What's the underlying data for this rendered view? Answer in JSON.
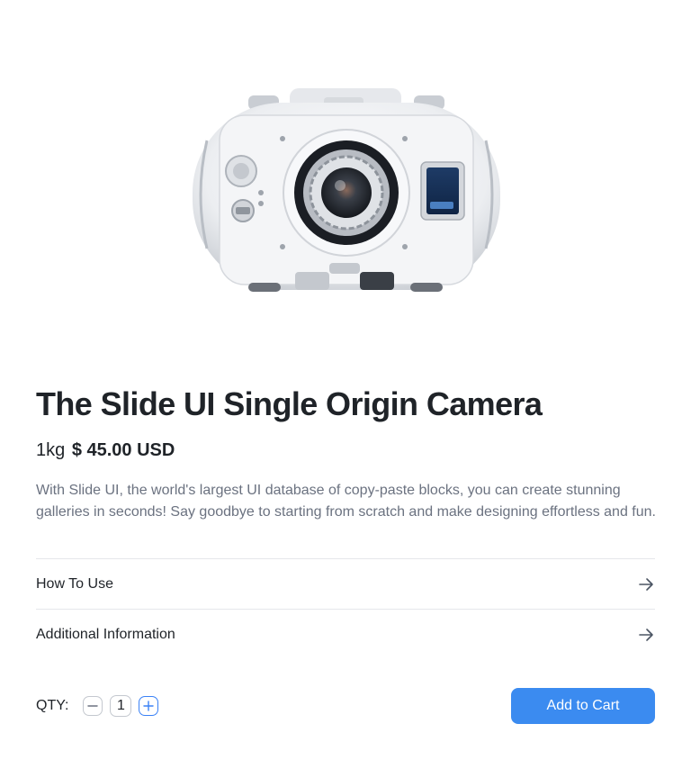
{
  "product": {
    "title": "The Slide UI Single Origin Camera",
    "weight": "1kg",
    "price": "$ 45.00 USD",
    "description": "With Slide UI, the world's largest UI database of copy-paste blocks, you can create stunning galleries in seconds! Say goodbye to starting from scratch and make designing effortless and fun.",
    "image_icon": "camera-icon"
  },
  "accordions": [
    {
      "label": "How To Use",
      "icon": "arrow-right-icon"
    },
    {
      "label": "Additional Information",
      "icon": "arrow-right-icon"
    }
  ],
  "quantity": {
    "label": "QTY:",
    "value": "1",
    "minus_icon": "minus-icon",
    "plus_icon": "plus-icon"
  },
  "cart": {
    "button_label": "Add to Cart"
  },
  "colors": {
    "accent": "#3b8bf0",
    "text": "#1f2328",
    "muted": "#6b7280",
    "divider": "#e5e7eb"
  }
}
